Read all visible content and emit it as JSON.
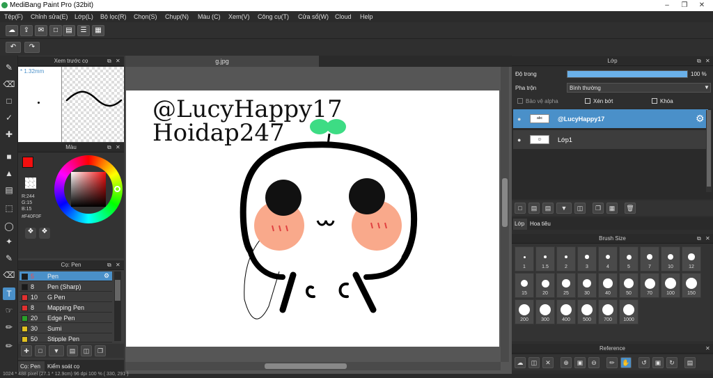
{
  "app": {
    "title": "MediBang Paint Pro (32bit)"
  },
  "menu": [
    "Tệp(F)",
    "Chỉnh sửa(E)",
    "Lớp(L)",
    "Bộ lọc(R)",
    "Chọn(S)",
    "Chụp(N)",
    "Màu (C)",
    "Xem(V)",
    "Công cụ(T)",
    "Cửa sổ(W)",
    "Cloud",
    "Help"
  ],
  "document": {
    "tab": "g.jpg",
    "text_line1": "@LucyHappy17",
    "text_line2": "Hoidap247"
  },
  "preview_panel": {
    "title": "Xem trước cọ",
    "size": "1.32mm"
  },
  "color_panel": {
    "title": "Màu",
    "r": "R:244",
    "g": "G:15",
    "b": "B:15",
    "hex": "#F40F0F",
    "fg_color": "#f40f0f"
  },
  "brush_panel": {
    "title": "Cọ: Pen",
    "items": [
      {
        "size": "5",
        "name": "Pen",
        "color": "#1a1a1a"
      },
      {
        "size": "8",
        "name": "Pen (Sharp)",
        "color": "#1a1a1a"
      },
      {
        "size": "10",
        "name": "G Pen",
        "color": "#e03030"
      },
      {
        "size": "8",
        "name": "Mapping Pen",
        "color": "#e03030"
      },
      {
        "size": "20",
        "name": "Edge Pen",
        "color": "#2aa02a"
      },
      {
        "size": "30",
        "name": "Sumi",
        "color": "#e0c020"
      },
      {
        "size": "50",
        "name": "Stipple Pen",
        "color": "#e0c020"
      }
    ]
  },
  "bottom_tabs": {
    "tab1": "Cọ: Pen",
    "tab2": "Kiểm soát cọ"
  },
  "layer_panel": {
    "title": "Lớp",
    "opacity_label": "Độ trong",
    "opacity_value": "100 %",
    "opacity": 1.0,
    "blend_label": "Pha trộn",
    "blend_value": "Bình thường",
    "protect_alpha": "Bảo vệ alpha",
    "clipping": "Xén bớt",
    "lock": "Khóa",
    "layers": [
      {
        "name": "@LucyHappy17"
      },
      {
        "name": "Lớp1"
      }
    ],
    "tab1": "Lớp",
    "tab2": "Hoa tiêu"
  },
  "brush_size_panel": {
    "title": "Brush Size",
    "sizes": [
      "1",
      "1.5",
      "2",
      "3",
      "4",
      "5",
      "7",
      "10",
      "12",
      "15",
      "20",
      "25",
      "30",
      "40",
      "50",
      "70",
      "100",
      "150",
      "200",
      "300",
      "400",
      "500",
      "700",
      "1000"
    ]
  },
  "reference_panel": {
    "title": "Reference"
  },
  "status": {
    "text": "1024 * 488 pixel   (27.1 * 12.9cm)   96 dpi   100 %   ( 330, 291 )"
  }
}
